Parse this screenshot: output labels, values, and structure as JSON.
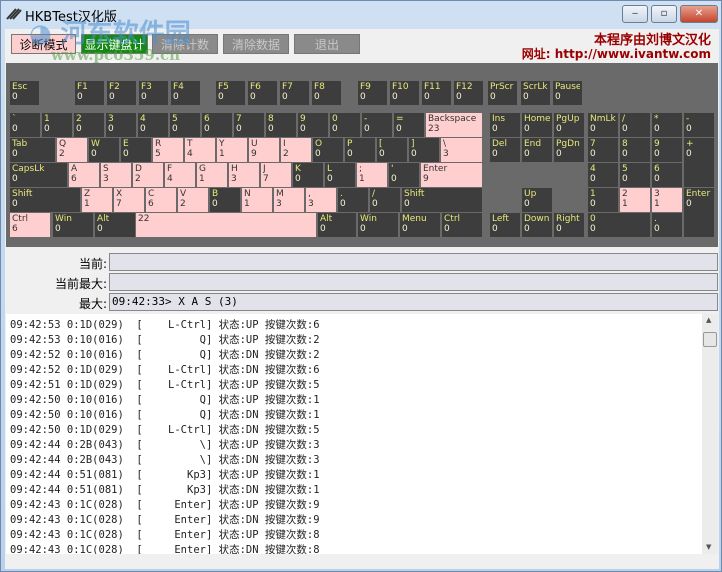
{
  "window": {
    "title": "HKBTest汉化版",
    "min": "‒",
    "max": "▫",
    "close": "✕"
  },
  "toolbar": {
    "diagnose": "诊断模式",
    "show_count": "显示键盘计数",
    "clear_count": "清除计数",
    "clear_data": "清除数据",
    "exit": "退出",
    "show_count_color": "#138a13"
  },
  "credit": {
    "line1": "本程序由刘博文汉化",
    "line2": "网址: http://www.ivantw.com"
  },
  "watermark": {
    "line1": "河东软件园",
    "line2": "www.pc0359.cn"
  },
  "colors": {
    "key": "#3d3d3d",
    "key_active": "#ffcfcf",
    "panel": "#6a6a6a"
  },
  "keys": [
    [
      "Esc",
      "0",
      0
    ],
    [
      "F1",
      "0",
      0
    ],
    [
      "F2",
      "0",
      0
    ],
    [
      "F3",
      "0",
      0
    ],
    [
      "F4",
      "0",
      0
    ],
    [
      "F5",
      "0",
      0
    ],
    [
      "F6",
      "0",
      0
    ],
    [
      "F7",
      "0",
      0
    ],
    [
      "F8",
      "0",
      0
    ],
    [
      "F9",
      "0",
      0
    ],
    [
      "F10",
      "0",
      0
    ],
    [
      "F11",
      "0",
      0
    ],
    [
      "F12",
      "0",
      0
    ],
    [
      "PrScr",
      "0",
      0
    ],
    [
      "ScrLk",
      "0",
      0
    ],
    [
      "Pause",
      "0",
      0
    ],
    [
      "`",
      "0",
      0
    ],
    [
      "1",
      "0",
      0
    ],
    [
      "2",
      "0",
      0
    ],
    [
      "3",
      "0",
      0
    ],
    [
      "4",
      "0",
      0
    ],
    [
      "5",
      "0",
      0
    ],
    [
      "6",
      "0",
      0
    ],
    [
      "7",
      "0",
      0
    ],
    [
      "8",
      "0",
      0
    ],
    [
      "9",
      "0",
      0
    ],
    [
      "0",
      "0",
      0
    ],
    [
      "-",
      "0",
      0
    ],
    [
      "=",
      "0",
      0
    ],
    [
      "Backspace",
      "23",
      1
    ],
    [
      "Ins",
      "0",
      0
    ],
    [
      "Home",
      "0",
      0
    ],
    [
      "PgUp",
      "0",
      0
    ],
    [
      "NmLk",
      "0",
      0
    ],
    [
      "/",
      "0",
      0
    ],
    [
      "*",
      "0",
      0
    ],
    [
      "-",
      "0",
      0
    ],
    [
      "Tab",
      "0",
      0
    ],
    [
      "Q",
      "2",
      1
    ],
    [
      "W",
      "0",
      0
    ],
    [
      "E",
      "0",
      0
    ],
    [
      "R",
      "5",
      1
    ],
    [
      "T",
      "4",
      1
    ],
    [
      "Y",
      "1",
      1
    ],
    [
      "U",
      "9",
      1
    ],
    [
      "I",
      "2",
      1
    ],
    [
      "O",
      "0",
      0
    ],
    [
      "P",
      "0",
      0
    ],
    [
      "[",
      "0",
      0
    ],
    [
      "]",
      "0",
      0
    ],
    [
      "\\",
      "3",
      1
    ],
    [
      "Del",
      "0",
      0
    ],
    [
      "End",
      "0",
      0
    ],
    [
      "PgDn",
      "0",
      0
    ],
    [
      "7",
      "0",
      0
    ],
    [
      "8",
      "0",
      0
    ],
    [
      "9",
      "0",
      0
    ],
    [
      "+",
      "0",
      0
    ],
    [
      "CapsLk",
      "0",
      0
    ],
    [
      "A",
      "6",
      1
    ],
    [
      "S",
      "3",
      1
    ],
    [
      "D",
      "2",
      1
    ],
    [
      "F",
      "4",
      1
    ],
    [
      "G",
      "1",
      1
    ],
    [
      "H",
      "3",
      1
    ],
    [
      "J",
      "7",
      1
    ],
    [
      "K",
      "0",
      0
    ],
    [
      "L",
      "0",
      0
    ],
    [
      ";",
      "1",
      1
    ],
    [
      "'",
      "0",
      0
    ],
    [
      "Enter",
      "9",
      1
    ],
    [
      "4",
      "0",
      0
    ],
    [
      "5",
      "0",
      0
    ],
    [
      "6",
      "0",
      0
    ],
    [
      "Shift",
      "0",
      0
    ],
    [
      "Z",
      "1",
      1
    ],
    [
      "X",
      "7",
      1
    ],
    [
      "C",
      "6",
      1
    ],
    [
      "V",
      "2",
      1
    ],
    [
      "B",
      "0",
      0
    ],
    [
      "N",
      "1",
      1
    ],
    [
      "M",
      "3",
      1
    ],
    [
      ",",
      "3",
      1
    ],
    [
      ".",
      "0",
      0
    ],
    [
      "/",
      "0",
      0
    ],
    [
      "Shift",
      "0",
      0
    ],
    [
      "Up",
      "0",
      0
    ],
    [
      "1",
      "0",
      0
    ],
    [
      "2",
      "1",
      1
    ],
    [
      "3",
      "1",
      1
    ],
    [
      "Enter",
      "0",
      0
    ],
    [
      "Ctrl",
      "6",
      1
    ],
    [
      "Win",
      "0",
      0
    ],
    [
      "Alt",
      "0",
      0
    ],
    [
      "",
      "22",
      1
    ],
    [
      "Alt",
      "0",
      0
    ],
    [
      "Win",
      "0",
      0
    ],
    [
      "Menu",
      "0",
      0
    ],
    [
      "Ctrl",
      "0",
      0
    ],
    [
      "Left",
      "0",
      0
    ],
    [
      "Down",
      "0",
      0
    ],
    [
      "Right",
      "0",
      0
    ],
    [
      "0",
      "0",
      0
    ],
    [
      ".",
      "0",
      0
    ]
  ],
  "status": {
    "current_label": "当前:",
    "current": "",
    "current_max_label": "当前最大:",
    "current_max": "",
    "max_label": "最大:",
    "max": "09:42:33> X A S (3)"
  },
  "log": [
    "09:42:53 0:1D(029)  [    L-Ctrl] 状态:UP 按键次数:6",
    "09:42:53 0:10(016)  [         Q] 状态:UP 按键次数:2",
    "09:42:52 0:10(016)  [         Q] 状态:DN 按键次数:2",
    "09:42:52 0:1D(029)  [    L-Ctrl] 状态:DN 按键次数:6",
    "09:42:51 0:1D(029)  [    L-Ctrl] 状态:UP 按键次数:5",
    "09:42:50 0:10(016)  [         Q] 状态:UP 按键次数:1",
    "09:42:50 0:10(016)  [         Q] 状态:DN 按键次数:1",
    "09:42:50 0:1D(029)  [    L-Ctrl] 状态:DN 按键次数:5",
    "09:42:44 0:2B(043)  [         \\] 状态:UP 按键次数:3",
    "09:42:44 0:2B(043)  [         \\] 状态:DN 按键次数:3",
    "09:42:44 0:51(081)  [       Kp3] 状态:UP 按键次数:1",
    "09:42:44 0:51(081)  [       Kp3] 状态:DN 按键次数:1",
    "09:42:43 0:1C(028)  [     Enter] 状态:UP 按键次数:9",
    "09:42:43 0:1C(028)  [     Enter] 状态:DN 按键次数:9",
    "09:42:43 0:1C(028)  [     Enter] 状态:UP 按键次数:8",
    "09:42:43 0:1C(028)  [     Enter] 状态:DN 按键次数:8"
  ]
}
